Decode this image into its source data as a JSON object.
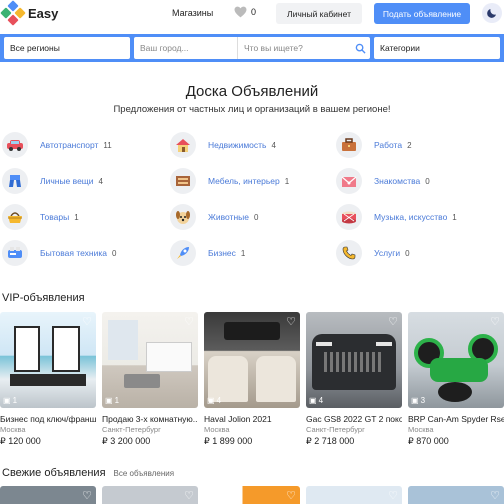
{
  "header": {
    "logo_text": "Easy",
    "shops_label": "Магазины",
    "favorites_count": "0",
    "cabinet_label": "Личный кабинет",
    "post_label": "Подать объявление"
  },
  "search": {
    "region": "Все регионы",
    "city_placeholder": "Ваш город...",
    "query_placeholder": "Что вы ищете?",
    "category": "Категории"
  },
  "board": {
    "title": "Доска Объявлений",
    "subtitle": "Предложения от частных лиц и организаций в вашем регионе!"
  },
  "categories": [
    {
      "name": "Автотранспорт",
      "count": "11",
      "icon": "car-icon"
    },
    {
      "name": "Недвижимость",
      "count": "4",
      "icon": "house-icon"
    },
    {
      "name": "Работа",
      "count": "2",
      "icon": "briefcase-icon"
    },
    {
      "name": "Личные вещи",
      "count": "4",
      "icon": "clothes-icon"
    },
    {
      "name": "Мебель, интерьер",
      "count": "1",
      "icon": "furniture-icon"
    },
    {
      "name": "Знакомства",
      "count": "0",
      "icon": "love-letter-icon"
    },
    {
      "name": "Товары",
      "count": "1",
      "icon": "basket-icon"
    },
    {
      "name": "Животные",
      "count": "0",
      "icon": "dog-icon"
    },
    {
      "name": "Музыка, искусство",
      "count": "1",
      "icon": "drum-icon"
    },
    {
      "name": "Бытовая техника",
      "count": "0",
      "icon": "appliance-icon"
    },
    {
      "name": "Бизнес",
      "count": "1",
      "icon": "rocket-icon"
    },
    {
      "name": "Услуги",
      "count": "0",
      "icon": "phone-icon"
    }
  ],
  "vip": {
    "title": "VIP-объявления",
    "items": [
      {
        "title": "Бизнес под ключ/франш...",
        "city": "Москва",
        "price": "₽ 120 000",
        "photos": "1"
      },
      {
        "title": "Продаю 3-х комнатную...",
        "city": "Санкт-Петербург",
        "price": "₽ 3 200 000",
        "photos": "1"
      },
      {
        "title": "Haval Jolion 2021",
        "city": "Москва",
        "price": "₽ 1 899 000",
        "photos": "4"
      },
      {
        "title": "Gac GS8 2022 GT 2 поко...",
        "city": "Санкт-Петербург",
        "price": "₽ 2 718 000",
        "photos": "4"
      },
      {
        "title": "BRP Can-Am Spyder Rse...",
        "city": "Москва",
        "price": "₽ 870 000",
        "photos": "3"
      }
    ]
  },
  "fresh": {
    "title": "Свежие объявления",
    "all_label": "Все объявления"
  },
  "colors": {
    "accent": "#4f8ef7",
    "link": "#4a7ad8"
  }
}
